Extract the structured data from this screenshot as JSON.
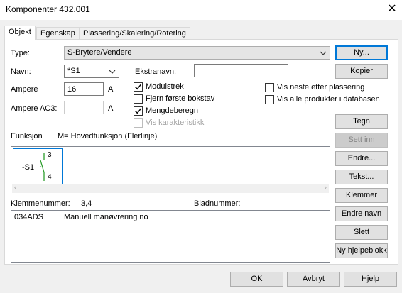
{
  "window": {
    "title": "Komponenter  432.001",
    "close_glyph": "✕"
  },
  "tabs": [
    "Objekt",
    "Egenskap",
    "Plassering/Skalering/Rotering"
  ],
  "form": {
    "type_label": "Type:",
    "type_value": "S-Brytere/Vendere",
    "navn_label": "Navn:",
    "navn_value": "*S1",
    "ekstranavn_label": "Ekstranavn:",
    "ekstranavn_value": "",
    "ampere_label": "Ampere",
    "ampere_value": "16",
    "ampere_unit": "A",
    "ampere_ac3_label": "Ampere AC3:",
    "ampere_ac3_value": "",
    "ampere_ac3_unit": "A"
  },
  "checkboxes": [
    {
      "label": "Modulstrek",
      "checked": true,
      "disabled": false
    },
    {
      "label": "Fjern første bokstav",
      "checked": false,
      "disabled": false
    },
    {
      "label": "Mengdeberegn",
      "checked": true,
      "disabled": false
    },
    {
      "label": "Vis karakteristikk",
      "checked": false,
      "disabled": true
    }
  ],
  "right_checkboxes": [
    {
      "label": "Vis neste etter plassering",
      "checked": false
    },
    {
      "label": "Vis alle produkter i databasen",
      "checked": false
    }
  ],
  "funksjon": {
    "label": "Funksjon",
    "value": "M= Hovedfunksjon (Flerlinje)",
    "symbol": {
      "name": "-S1",
      "pin_top": "3",
      "pin_bottom": "4"
    }
  },
  "klemmer": {
    "label": "Klemmenummer:",
    "value": "3,4",
    "blad_label": "Bladnummer:",
    "blad_value": ""
  },
  "list": [
    {
      "code": "034ADS",
      "desc": "Manuell manøvrering no"
    }
  ],
  "buttons": {
    "ny": "Ny...",
    "kopier": "Kopier",
    "tegn": "Tegn",
    "sett_inn": "Sett inn",
    "endre": "Endre...",
    "tekst": "Tekst...",
    "klemmer": "Klemmer",
    "endre_navn": "Endre navn",
    "slett": "Slett",
    "ny_hjelpeblokk": "Ny hjelpeblokk",
    "ok": "OK",
    "avbryt": "Avbryt",
    "hjelp": "Hjelp"
  }
}
